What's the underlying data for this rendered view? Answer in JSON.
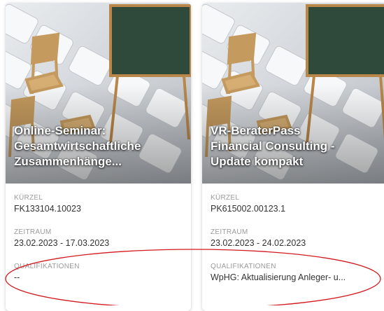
{
  "colors": {
    "annotation_ellipse": "#d2191e",
    "label": "#9a9a9a",
    "value": "#333333"
  },
  "cards": [
    {
      "title_lines": [
        "Online-Seminar:",
        "Gesamtwirtschaftliche",
        "Zusammenhänge..."
      ],
      "fields": [
        {
          "label": "KÜRZEL",
          "value": "FK133104.10023"
        },
        {
          "label": "ZEITRAUM",
          "value": "23.02.2023 - 17.03.2023"
        },
        {
          "label": "QUALIFIKATIONEN",
          "value": "--"
        }
      ]
    },
    {
      "title_lines": [
        "VR-BeraterPass",
        "Financial Consulting -",
        "Update kompakt"
      ],
      "fields": [
        {
          "label": "KÜRZEL",
          "value": "PK615002.00123.1"
        },
        {
          "label": "ZEITRAUM",
          "value": "23.02.2023 - 24.02.2023"
        },
        {
          "label": "QUALIFIKATIONEN",
          "value": "WpHG: Aktualisierung Anleger- u..."
        }
      ]
    }
  ]
}
